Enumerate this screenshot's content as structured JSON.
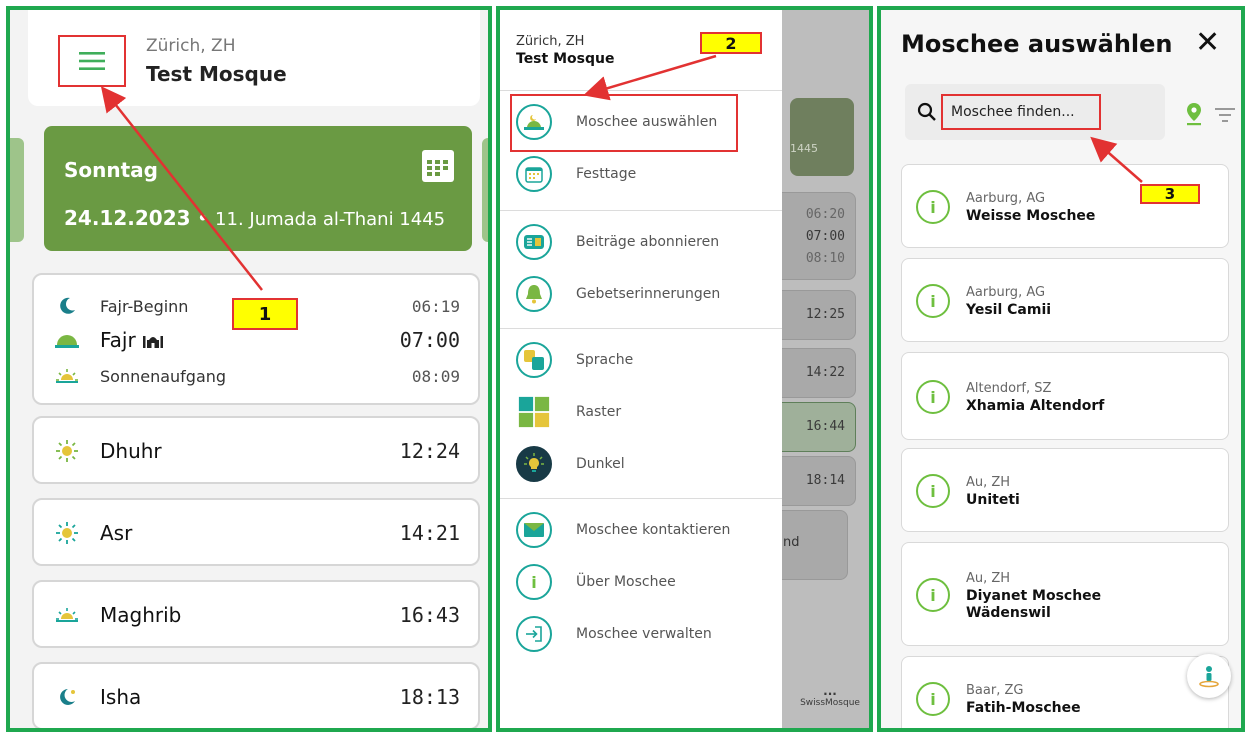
{
  "panel1": {
    "location_city": "Zürich, ZH",
    "mosque_name": "Test Mosque",
    "day": "Sonntag",
    "date": "24.12.2023",
    "separator": " • ",
    "hijri": "11. Jumada al-Thani 1445",
    "fajr_group": [
      {
        "name": "Fajr-Beginn",
        "time": "06:19",
        "icon": "crescent-moon-icon"
      },
      {
        "name": "Fajr",
        "time": "07:00",
        "icon": "dawn-icon",
        "badge": "mosque-icon"
      },
      {
        "name": "Sonnenaufgang",
        "time": "08:09",
        "icon": "sunrise-icon"
      }
    ],
    "prayers": [
      {
        "name": "Dhuhr",
        "time": "12:24",
        "icon": "sun-icon"
      },
      {
        "name": "Asr",
        "time": "14:21",
        "icon": "sun-icon"
      },
      {
        "name": "Maghrib",
        "time": "16:43",
        "icon": "sunset-icon"
      },
      {
        "name": "Isha",
        "time": "18:13",
        "icon": "moon-star-icon"
      }
    ]
  },
  "panel2": {
    "location_city": "Zürich, ZH",
    "mosque_name": "Test Mosque",
    "menu": [
      {
        "label": "Moschee auswählen",
        "icon": "mosque-icon"
      },
      {
        "label": "Festtage",
        "icon": "calendar-icon"
      },
      {
        "label": "Beiträge abonnieren",
        "icon": "news-icon"
      },
      {
        "label": "Gebetserinnerungen",
        "icon": "bell-icon"
      },
      {
        "label": "Sprache",
        "icon": "translate-icon"
      },
      {
        "label": "Raster",
        "icon": "grid-icon"
      },
      {
        "label": "Dunkel",
        "icon": "bulb-icon"
      },
      {
        "label": "Moschee kontaktieren",
        "icon": "mail-icon"
      },
      {
        "label": "Über Moschee",
        "icon": "info-icon"
      },
      {
        "label": "Moschee verwalten",
        "icon": "login-icon"
      }
    ],
    "background": {
      "hijri_fragment": "1445",
      "times_fajr": [
        "06:20",
        "07:00",
        "08:10"
      ],
      "times": [
        "12:25",
        "14:22",
        "16:44",
        "18:14"
      ],
      "fragment_text": "nd",
      "nav_dots": "...",
      "nav_label": "SwissMosque"
    }
  },
  "panel3": {
    "title": "Moschee auswählen",
    "close_symbol": "✕",
    "search_placeholder": "Moschee finden...",
    "mosques": [
      {
        "city": "Aarburg, AG",
        "name": "Weisse Moschee"
      },
      {
        "city": "Aarburg, AG",
        "name": "Yesil Camii"
      },
      {
        "city": "Altendorf, SZ",
        "name": "Xhamia Altendorf"
      },
      {
        "city": "Au, ZH",
        "name": "Uniteti"
      },
      {
        "city": "Au, ZH",
        "name": "Diyanet Moschee Wädenswil"
      },
      {
        "city": "Baar, ZG",
        "name": "Fatih-Moschee"
      }
    ]
  },
  "annotations": [
    "1",
    "2",
    "3"
  ],
  "colors": {
    "frame": "#1fa84f",
    "accent_green": "#6a9a43",
    "teal": "#1aa59a",
    "annotation": "#e23232",
    "label_bg": "#ffff00"
  }
}
